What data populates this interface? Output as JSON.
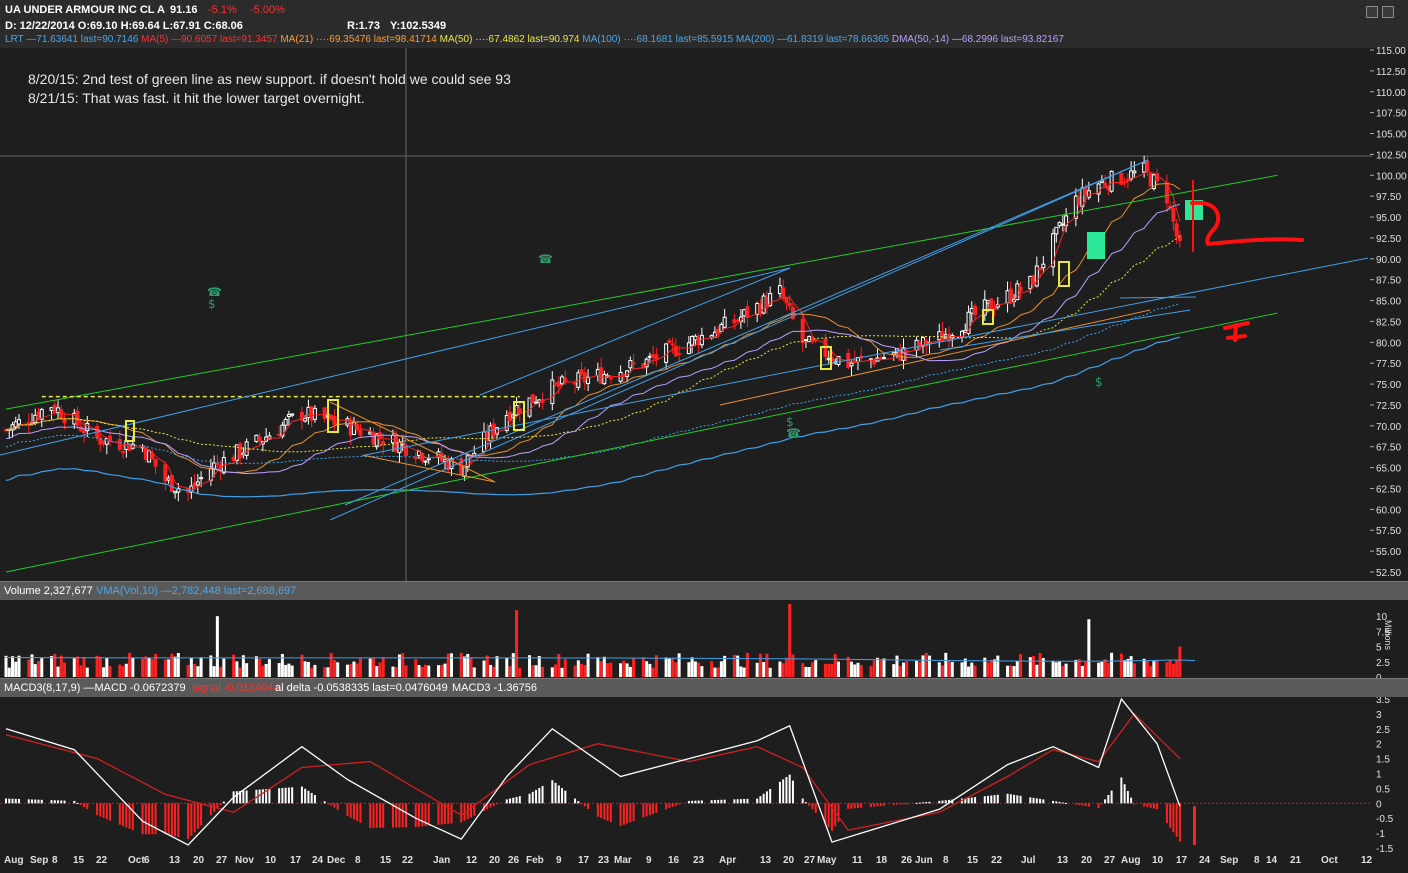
{
  "header": {
    "symbol_name": "UA UNDER ARMOUR INC CL A",
    "last": "91.16",
    "change": "-5.1%",
    "change_pct": "-5.00%",
    "ohlc": "D: 12/22/2014 O:69.10 H:69.64 L:67.91 C:68.06",
    "ratio": "R:1.73",
    "ycoord": "Y:102.5349",
    "overlays": [
      {
        "text": "LRT —71.63641 last=90.7146",
        "color": "#4aa8e8"
      },
      {
        "text": "MA(5) —90.6057 last=91.3457",
        "color": "#ff3030"
      },
      {
        "text": "MA(21) ····69.35476 last=98.41714",
        "color": "#ff9b30"
      },
      {
        "text": "MA(50) ····67.4862 last=90.974",
        "color": "#e6e640"
      },
      {
        "text": "MA(100) ····68.1681 last=85.5915",
        "color": "#4aa8e8"
      },
      {
        "text": "MA(200) —61.8319 last=78.66365",
        "color": "#4aa8e8"
      },
      {
        "text": "DMA(50,-14) —68.2996 last=93.82167",
        "color": "#b9a0ff"
      }
    ]
  },
  "annotations": [
    "8/20/15: 2nd test of green line as new support. if doesn't hold we could see 93",
    "8/21/15: That was fast. it hit the lower target overnight."
  ],
  "volume_header": {
    "label": "Volume 2,327,677",
    "vma": "VMA(Vol,10) —2,782,448 last=2,688,697",
    "vma_color": "#4aa8e8",
    "unit": "Millions"
  },
  "macd_header": {
    "label": "MACD3(8,17,9) —MACD -0.0672379",
    "signal": "signal -0.0134044",
    "delta": "al delta -0.0538335 last=0.0476049",
    "last2": "MACD3 -1.36756",
    "signal_color": "#ff3030"
  },
  "colors": {
    "up": "#ffffff",
    "down": "#ff2020",
    "green": "#22cc22",
    "blue": "#3fa0e8",
    "orange": "#e8902a",
    "yellow": "#e8e840",
    "purple": "#b9a0ff",
    "mint": "#2ee89a"
  },
  "chart_data": {
    "type": "line",
    "title": "UA UNDER ARMOUR INC CL A",
    "price_axis": {
      "ylim": [
        52.5,
        115.0
      ],
      "ticks": [
        "115.00",
        "112.50",
        "110.00",
        "107.50",
        "105.00",
        "102.50",
        "100.00",
        "97.50",
        "95.00",
        "92.50",
        "90.00",
        "87.50",
        "85.00",
        "82.50",
        "80.00",
        "77.50",
        "75.00",
        "72.50",
        "70.00",
        "67.50",
        "65.00",
        "62.50",
        "60.00",
        "57.50",
        "55.00",
        "52.50"
      ]
    },
    "volume_axis": {
      "ylim": [
        0,
        12
      ],
      "ticks": [
        "10",
        "7.5",
        "5",
        "2.5",
        "0"
      ]
    },
    "macd_axis": {
      "ylim": [
        -1.6,
        3.6
      ],
      "ticks": [
        "3.5",
        "3",
        "2.5",
        "2",
        "1.5",
        "1",
        "0.5",
        "0",
        "-0.5",
        "-1",
        "-1.5"
      ]
    },
    "x_labels": [
      "Aug",
      "Sep",
      "8",
      "15",
      "22",
      "Oct",
      "6",
      "13",
      "20",
      "27",
      "Nov",
      "10",
      "17",
      "24",
      "Dec",
      "8",
      "15",
      "22",
      "Jan",
      "12",
      "20",
      "26",
      "Feb",
      "9",
      "17",
      "23",
      "Mar",
      "9",
      "16",
      "23",
      "Apr",
      "13",
      "20",
      "27",
      "May",
      "11",
      "18",
      "26",
      "Jun",
      "8",
      "15",
      "22",
      "Jul",
      "13",
      "20",
      "27",
      "Aug",
      "10",
      "17",
      "24",
      "Sep",
      "8",
      "14",
      "21",
      "Oct",
      "12"
    ],
    "x_label_bold": [
      "Aug",
      "Sep",
      "Oct",
      "Nov",
      "Dec",
      "Jan",
      "Feb",
      "Mar",
      "Apr",
      "May",
      "Jun",
      "Jul",
      "Sep",
      "Oct"
    ],
    "close_series": {
      "name": "UA daily close (approx.)",
      "x": [
        "2014-08-25",
        "2014-09-08",
        "2014-09-22",
        "2014-10-06",
        "2014-10-13",
        "2014-10-20",
        "2014-10-27",
        "2014-11-10",
        "2014-11-24",
        "2014-12-08",
        "2014-12-22",
        "2015-01-12",
        "2015-01-26",
        "2015-02-09",
        "2015-02-23",
        "2015-03-09",
        "2015-03-23",
        "2015-04-06",
        "2015-04-20",
        "2015-04-27",
        "2015-05-11",
        "2015-05-26",
        "2015-06-08",
        "2015-06-22",
        "2015-07-06",
        "2015-07-20",
        "2015-07-27",
        "2015-08-10",
        "2015-08-17",
        "2015-08-21"
      ],
      "values": [
        69.5,
        72.5,
        68.5,
        67.5,
        63.5,
        62.0,
        65.0,
        68.0,
        71.5,
        70.0,
        68.1,
        65.0,
        71.5,
        74.5,
        76.0,
        77.5,
        80.0,
        82.5,
        86.0,
        80.0,
        77.5,
        78.5,
        80.5,
        84.0,
        87.0,
        97.0,
        99.0,
        100.5,
        97.5,
        91.16
      ]
    },
    "volume_spikes_millions": [
      {
        "x": "2014-10-29",
        "value": 10.0
      },
      {
        "x": "2015-01-29",
        "value": 11.0
      },
      {
        "x": "2015-04-23",
        "value": 12.0
      },
      {
        "x": "2015-07-24",
        "value": 9.5
      },
      {
        "x": "2015-08-21",
        "value": 5.0
      }
    ],
    "macd_series": {
      "name": "MACD",
      "x": [
        "2014-08-25",
        "2014-09-15",
        "2014-10-06",
        "2014-10-20",
        "2014-11-03",
        "2014-11-24",
        "2014-12-08",
        "2014-12-29",
        "2015-01-12",
        "2015-01-26",
        "2015-02-09",
        "2015-03-02",
        "2015-03-23",
        "2015-04-13",
        "2015-04-23",
        "2015-05-06",
        "2015-05-18",
        "2015-06-08",
        "2015-06-29",
        "2015-07-13",
        "2015-07-27",
        "2015-08-03",
        "2015-08-14",
        "2015-08-21"
      ],
      "values": [
        2.5,
        1.8,
        -0.6,
        -1.4,
        0.2,
        1.9,
        0.8,
        -0.5,
        -1.2,
        0.9,
        2.5,
        0.9,
        1.5,
        2.1,
        2.6,
        -1.3,
        -0.9,
        -0.2,
        1.3,
        1.9,
        1.2,
        3.5,
        2.0,
        -0.1
      ]
    },
    "signal_series": {
      "name": "signal",
      "x": [
        "2014-08-25",
        "2014-09-22",
        "2014-10-13",
        "2014-11-03",
        "2014-11-24",
        "2014-12-15",
        "2015-01-12",
        "2015-02-02",
        "2015-02-23",
        "2015-03-23",
        "2015-04-13",
        "2015-04-27",
        "2015-05-11",
        "2015-06-08",
        "2015-06-29",
        "2015-07-13",
        "2015-07-27",
        "2015-08-07",
        "2015-08-21"
      ],
      "values": [
        2.3,
        1.5,
        0.3,
        -0.3,
        1.2,
        1.4,
        -0.4,
        1.3,
        2.0,
        1.4,
        1.9,
        1.2,
        -0.9,
        -0.3,
        0.9,
        1.8,
        1.4,
        3.0,
        1.5
      ]
    },
    "trend_lines": [
      {
        "name": "upper green channel",
        "from": [
          "2014-08-25",
          72.0
        ],
        "to": [
          "2015-09-20",
          100.0
        ],
        "color": "green"
      },
      {
        "name": "lower green channel",
        "from": [
          "2014-08-25",
          52.5
        ],
        "to": [
          "2015-09-20",
          83.5
        ],
        "color": "green"
      },
      {
        "name": "horizontal resistance",
        "from": [
          "2014-09-05",
          73.5
        ],
        "to": [
          "2015-01-30",
          73.5
        ],
        "color": "yellow"
      }
    ],
    "grid": false,
    "legend": "top-left"
  }
}
